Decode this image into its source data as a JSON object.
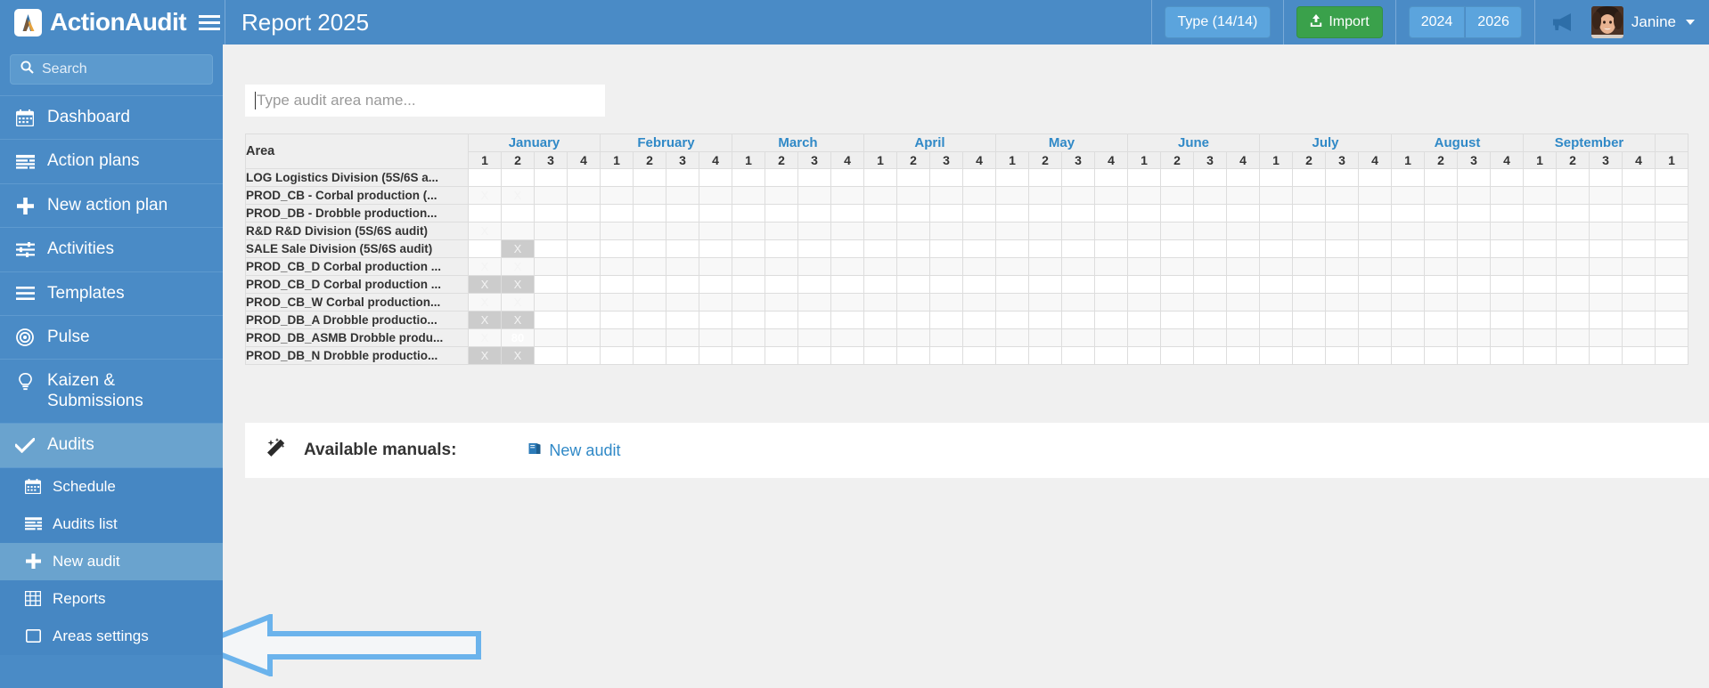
{
  "app": {
    "brand": "ActionAudit",
    "page_title": "Report 2025",
    "menu_icon": "hamburger-icon",
    "logo_icon": "actionaudit-logo-icon"
  },
  "topbar": {
    "type_button": "Type (14/14)",
    "import_button": "Import",
    "import_icon": "upload-icon",
    "year_prev": "2024",
    "year_next": "2026",
    "megaphone_icon": "megaphone-icon",
    "avatar_icon": "user-avatar",
    "user_name": "Janine",
    "caret_icon": "chevron-down-icon"
  },
  "sidebar": {
    "search_placeholder": "Search",
    "search_icon": "search-icon",
    "items": [
      {
        "label": "Dashboard",
        "icon": "calendar-icon",
        "active": false
      },
      {
        "label": "Action plans",
        "icon": "list-lines-icon",
        "active": false
      },
      {
        "label": "New action plan",
        "icon": "plus-icon",
        "active": false
      },
      {
        "label": "Activities",
        "icon": "sliders-icon",
        "active": false
      },
      {
        "label": "Templates",
        "icon": "menu-lines-icon",
        "active": false
      },
      {
        "label": "Pulse",
        "icon": "target-icon",
        "active": false
      },
      {
        "label": "Kaizen & Submissions",
        "icon": "lightbulb-icon",
        "active": false
      },
      {
        "label": "Audits",
        "icon": "check-icon",
        "active": true
      }
    ],
    "sub_items": [
      {
        "label": "Schedule",
        "icon": "calendar-icon",
        "active": false
      },
      {
        "label": "Audits list",
        "icon": "list-lines-icon",
        "active": false
      },
      {
        "label": "New audit",
        "icon": "plus-icon",
        "active": true
      },
      {
        "label": "Reports",
        "icon": "table-grid-icon",
        "active": false
      },
      {
        "label": "Areas settings",
        "icon": "square-icon",
        "active": false
      }
    ]
  },
  "main": {
    "area_filter_placeholder": "Type audit area name...",
    "area_filter_value": "",
    "manuals_label": "Available manuals:",
    "manuals_icon": "magic-wand-icon",
    "new_audit_link": "New audit",
    "new_audit_link_icon": "book-icon",
    "annotation_arrow": "left-pointing-arrow"
  },
  "schedule": {
    "area_column_header": "Area",
    "months": [
      "January",
      "February",
      "March",
      "April",
      "May",
      "June",
      "July",
      "August",
      "September"
    ],
    "weeks": [
      "1",
      "2",
      "3",
      "4"
    ],
    "trailing_partial_week": "1",
    "rows": [
      {
        "area": "LOG Logistics Division (5S/6S a...",
        "marks": {}
      },
      {
        "area": "PROD_CB - Corbal production (...",
        "marks": {
          "0": "X",
          "1": "X"
        }
      },
      {
        "area": "PROD_DB - Drobble production...",
        "marks": {}
      },
      {
        "area": "R&D R&D Division (5S/6S audit)",
        "marks": {
          "0": "X"
        }
      },
      {
        "area": "SALE Sale Division (5S/6S audit)",
        "marks": {
          "1": "X"
        }
      },
      {
        "area": "PROD_CB_D Corbal production ...",
        "marks": {
          "0": "X",
          "1": "X"
        }
      },
      {
        "area": "PROD_CB_D Corbal production ...",
        "marks": {
          "0": "X",
          "1": "X"
        }
      },
      {
        "area": "PROD_CB_W Corbal production...",
        "marks": {
          "0": "X",
          "1": "X"
        }
      },
      {
        "area": "PROD_DB_A Drobble productio...",
        "marks": {
          "0": "X",
          "1": "X"
        }
      },
      {
        "area": "PROD_DB_ASMB Drobble produ...",
        "marks": {
          "0": "X"
        },
        "scores": {
          "1": "80"
        }
      },
      {
        "area": "PROD_DB_N Drobble productio...",
        "marks": {
          "0": "X",
          "1": "X"
        }
      }
    ]
  },
  "colors": {
    "header_blue": "#4a8bc6",
    "accent_blue": "#3089c7",
    "success_green": "#3aa14b",
    "score_green": "#5cb85c",
    "mark_gray": "#cccccc",
    "arrow_blue": "#6bb3ec"
  }
}
